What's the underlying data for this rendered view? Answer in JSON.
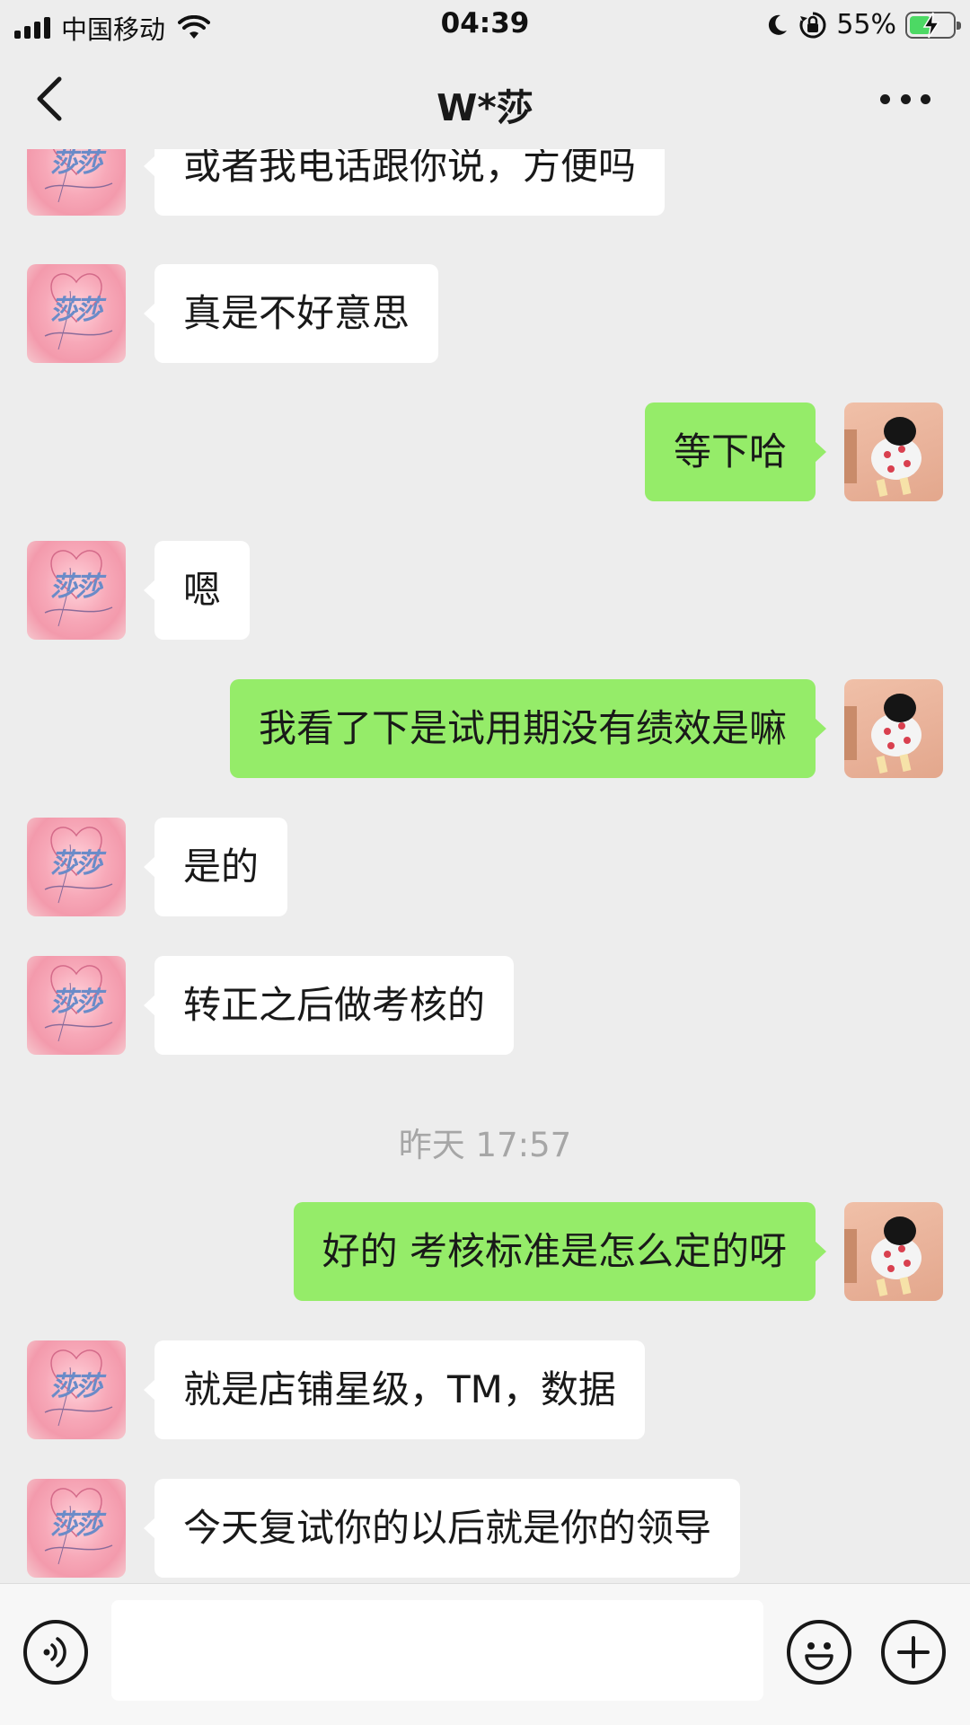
{
  "status_bar": {
    "carrier": "中国移动",
    "time": "04:39",
    "battery_percent": "55%",
    "battery_level": 0.55,
    "icons": [
      "signal-icon",
      "wifi-icon",
      "moon-icon",
      "rotation-lock-icon",
      "battery-charging-icon"
    ]
  },
  "nav": {
    "title": "W*莎",
    "back_icon": "chevron-left-icon",
    "more_icon": "more-dots-icon"
  },
  "messages": [
    {
      "side": "left",
      "text": "或者我电话跟你说，方便吗"
    },
    {
      "side": "left",
      "text": "真是不好意思"
    },
    {
      "side": "right",
      "text": "等下哈"
    },
    {
      "side": "left",
      "text": "嗯"
    },
    {
      "side": "right",
      "text": "我看了下是试用期没有绩效是嘛"
    },
    {
      "side": "left",
      "text": "是的"
    },
    {
      "side": "left",
      "text": "转正之后做考核的"
    },
    {
      "type": "timestamp",
      "text": "昨天 17:57"
    },
    {
      "side": "right",
      "text": "好的 考核标准是怎么定的呀"
    },
    {
      "side": "left",
      "text": "就是店铺星级，TM，数据"
    },
    {
      "side": "left",
      "text": "今天复试你的以后就是你的领导"
    }
  ],
  "avatars": {
    "contact_signature": "莎莎"
  },
  "input_bar": {
    "voice_icon": "voice-icon",
    "emoji_icon": "emoji-icon",
    "plus_icon": "plus-icon",
    "input_value": ""
  },
  "colors": {
    "background": "#ededed",
    "sent_bubble": "#95ec69",
    "received_bubble": "#ffffff",
    "timestamp_text": "#a6a6a6"
  }
}
